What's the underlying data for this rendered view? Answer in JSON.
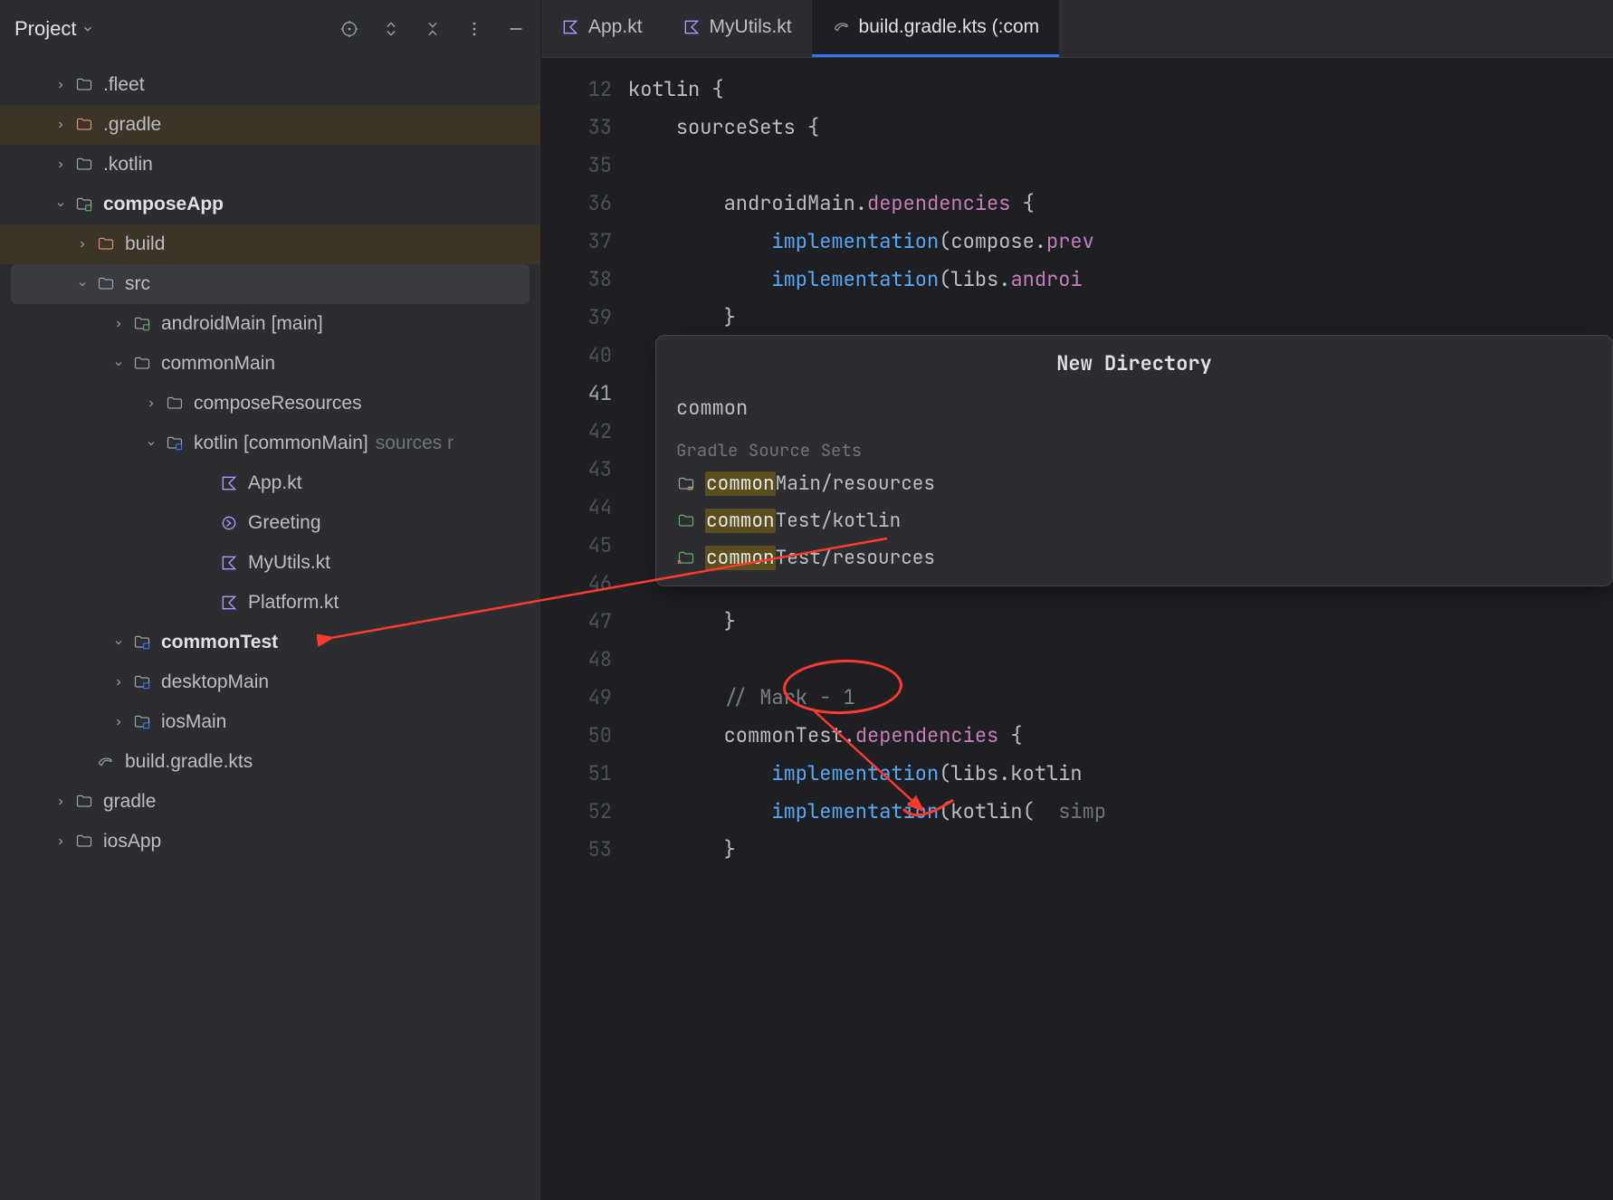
{
  "sidebar": {
    "title": "Project",
    "items": [
      {
        "label": ".fleet",
        "icon": "folder",
        "depth": 1,
        "expand": "right"
      },
      {
        "label": ".gradle",
        "icon": "folder-orange",
        "depth": 1,
        "expand": "right",
        "brown": true
      },
      {
        "label": ".kotlin",
        "icon": "folder",
        "depth": 1,
        "expand": "right"
      },
      {
        "label": "composeApp",
        "icon": "module",
        "depth": 1,
        "expand": "down",
        "bold": true
      },
      {
        "label": "build",
        "icon": "folder-orange",
        "depth": 2,
        "expand": "right",
        "brown": true
      },
      {
        "label": "src",
        "icon": "folder",
        "depth": 2,
        "expand": "down",
        "selected": true
      },
      {
        "label": "androidMain",
        "icon": "module-green",
        "depth": 3,
        "expand": "right",
        "bracket": "[main]"
      },
      {
        "label": "commonMain",
        "icon": "folder",
        "depth": 3,
        "expand": "down"
      },
      {
        "label": "composeResources",
        "icon": "folder",
        "depth": 4,
        "expand": "right"
      },
      {
        "label": "kotlin",
        "icon": "module-blue",
        "depth": 4,
        "expand": "down",
        "bracket": "[commonMain]",
        "hint": "sources r"
      },
      {
        "label": "App.kt",
        "icon": "kotlin",
        "depth": 5
      },
      {
        "label": "Greeting",
        "icon": "kotlin-circle",
        "depth": 5
      },
      {
        "label": "MyUtils.kt",
        "icon": "kotlin",
        "depth": 5
      },
      {
        "label": "Platform.kt",
        "icon": "kotlin",
        "depth": 5
      },
      {
        "label": "commonTest",
        "icon": "module-blue",
        "depth": 3,
        "expand": "down",
        "bold": true
      },
      {
        "label": "desktopMain",
        "icon": "module-blue",
        "depth": 3,
        "expand": "right"
      },
      {
        "label": "iosMain",
        "icon": "module-blue",
        "depth": 3,
        "expand": "right"
      },
      {
        "label": "build.gradle.kts",
        "icon": "gradle",
        "depth": 2
      },
      {
        "label": "gradle",
        "icon": "folder",
        "depth": 1,
        "expand": "right"
      },
      {
        "label": "iosApp",
        "icon": "folder",
        "depth": 1,
        "expand": "right"
      }
    ]
  },
  "tabs": [
    {
      "label": "App.kt",
      "icon": "kotlin"
    },
    {
      "label": "MyUtils.kt",
      "icon": "kotlin"
    },
    {
      "label": "build.gradle.kts (:com",
      "icon": "gradle",
      "active": true
    }
  ],
  "code": {
    "line_numbers": [
      "12",
      "33",
      "35",
      "36",
      "37",
      "38",
      "39",
      "40",
      "41",
      "42",
      "43",
      "44",
      "45",
      "46",
      "47",
      "48",
      "49",
      "50",
      "51",
      "52",
      "53"
    ],
    "lines": [
      "kotlin {",
      "    sourceSets {",
      "",
      "        androidMain.dependencies {",
      "            implementation(compose.prev",
      "            implementation(libs.androi",
      "        }",
      "",
      "",
      "",
      "",
      "",
      "",
      "",
      "        }",
      "",
      "        // Mark - 1",
      "        commonTest.dependencies {",
      "            implementation(libs.kotlin",
      "            implementation(kotlin( simp",
      "        }"
    ],
    "active_line_index": 8
  },
  "popup": {
    "title": "New Directory",
    "input_value": "common",
    "section": "Gradle Source Sets",
    "items": [
      {
        "match": "common",
        "rest": "Main/resources",
        "icon": "folder-res"
      },
      {
        "match": "common",
        "rest": "Test/kotlin",
        "icon": "folder-green"
      },
      {
        "match": "common",
        "rest": "Test/resources",
        "icon": "folder-testres"
      }
    ]
  },
  "icons": {
    "chevron_down": "⌄",
    "chevron_right": "›"
  }
}
